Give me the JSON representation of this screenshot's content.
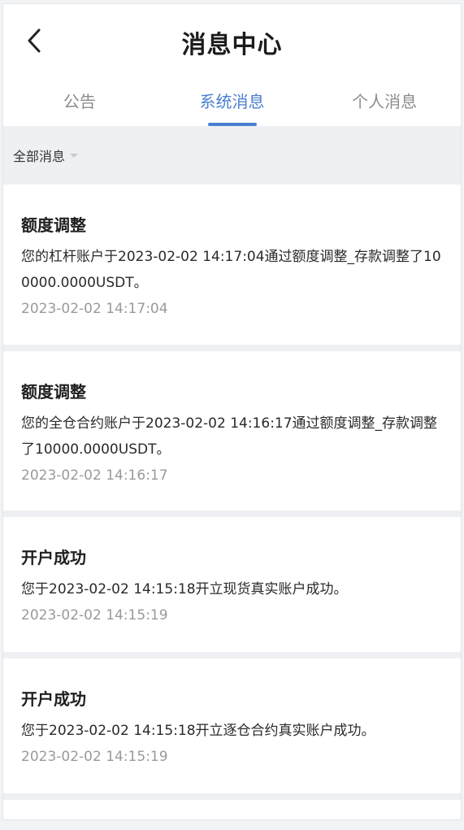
{
  "header": {
    "title": "消息中心"
  },
  "tabs": [
    {
      "label": "公告",
      "active": false
    },
    {
      "label": "系统消息",
      "active": true
    },
    {
      "label": "个人消息",
      "active": false
    }
  ],
  "filter": {
    "label": "全部消息"
  },
  "messages": [
    {
      "title": "额度调整",
      "body": "您的杠杆账户于2023-02-02 14:17:04通过额度调整_存款调整了100000.0000USDT。",
      "time": "2023-02-02 14:17:04"
    },
    {
      "title": "额度调整",
      "body": "您的全仓合约账户于2023-02-02 14:16:17通过额度调整_存款调整了10000.0000USDT。",
      "time": "2023-02-02 14:16:17"
    },
    {
      "title": "开户成功",
      "body": "您于2023-02-02 14:15:18开立现货真实账户成功。",
      "time": "2023-02-02 14:15:19"
    },
    {
      "title": "开户成功",
      "body": "您于2023-02-02 14:15:18开立逐仓合约真实账户成功。",
      "time": "2023-02-02 14:15:19"
    }
  ],
  "colors": {
    "accent": "#4a7fcf",
    "background": "#eef0f3",
    "muted_text": "#9a9a9a"
  },
  "icons": {
    "back": "chevron-left-icon",
    "filter_caret": "caret-down-icon"
  }
}
